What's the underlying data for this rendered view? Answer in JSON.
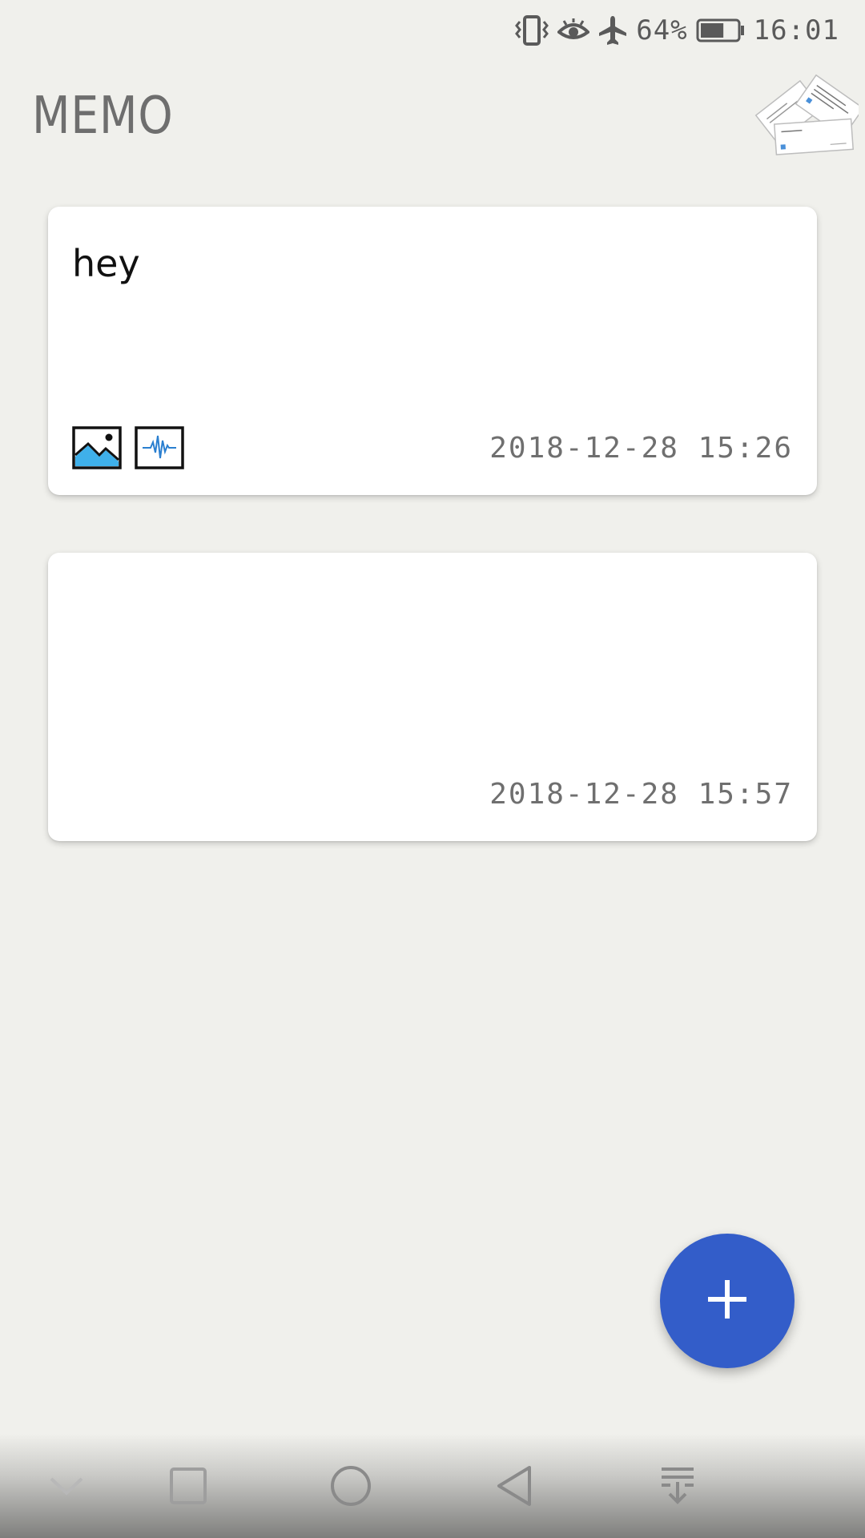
{
  "status_bar": {
    "battery_percent": "64%",
    "battery_level": 0.64,
    "time": "16:01",
    "icons": [
      "vibrate-icon",
      "eye-comfort-icon",
      "airplane-mode-icon",
      "battery-icon"
    ]
  },
  "header": {
    "title": "MEMO",
    "art_icon": "stacked-notes-illustration"
  },
  "memos": [
    {
      "text": "hey",
      "date": "2018-12-28 15:26",
      "attachments": [
        "image-attachment-icon",
        "audio-attachment-icon"
      ]
    },
    {
      "text": "",
      "date": "2018-12-28 15:57",
      "attachments": []
    }
  ],
  "fab": {
    "icon": "plus-icon"
  },
  "nav_bar": {
    "buttons": [
      "collapse-icon",
      "recents-icon",
      "home-icon",
      "back-icon",
      "notification-pull-icon"
    ]
  },
  "colors": {
    "background": "#f0f0ec",
    "card": "#ffffff",
    "accent": "#335dc9",
    "attachment_blue": "#3fb0ea"
  }
}
